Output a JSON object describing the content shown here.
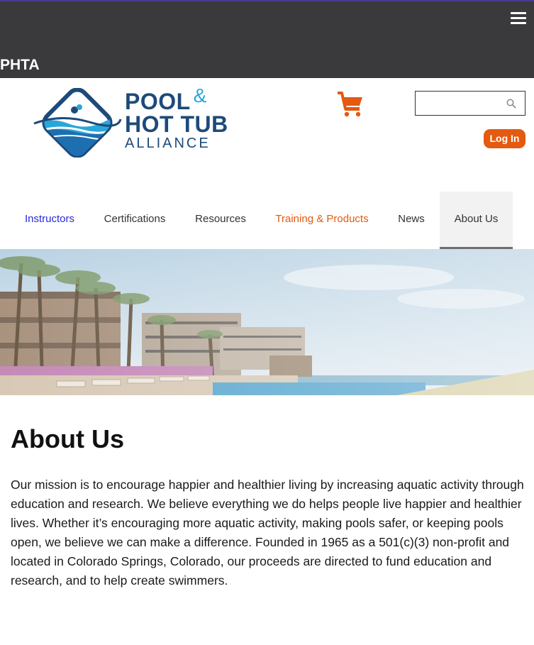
{
  "header": {
    "brand": "PHTA",
    "menu_icon": "hamburger-menu-icon"
  },
  "logo": {
    "line1": "POOL",
    "amp": "&",
    "line2": "HOT TUB",
    "line3": "ALLIANCE",
    "colors": {
      "navy": "#1d4a7a",
      "blue": "#2aa6d8"
    }
  },
  "cart": {
    "icon": "shopping-cart-icon",
    "color": "#e35a10"
  },
  "search": {
    "value": "",
    "placeholder": "",
    "icon": "search-icon"
  },
  "login": {
    "label": "Log In",
    "color": "#e35a10"
  },
  "nav": {
    "items": [
      {
        "label": "Instructors",
        "color": "#2a2ad8"
      },
      {
        "label": "Certifications",
        "color": "#333333"
      },
      {
        "label": "Resources",
        "color": "#333333"
      },
      {
        "label": "Training & Products",
        "color": "#e35a10"
      },
      {
        "label": "News",
        "color": "#333333"
      },
      {
        "label": "About Us",
        "color": "#333333",
        "active": true
      }
    ]
  },
  "content": {
    "title": "About Us",
    "body": "Our mission is to encourage happier and healthier living by increasing aquatic activity through education and research. We believe everything we do helps people live happier and healthier lives. Whether it’s encouraging more aquatic activity, making pools safer, or keeping pools open, we believe we can make a difference. Founded in 1965 as a 501(c)(3) non-profit and located in Colorado Springs, Colorado, our proceeds are directed to fund education and research, and to help create swimmers."
  }
}
